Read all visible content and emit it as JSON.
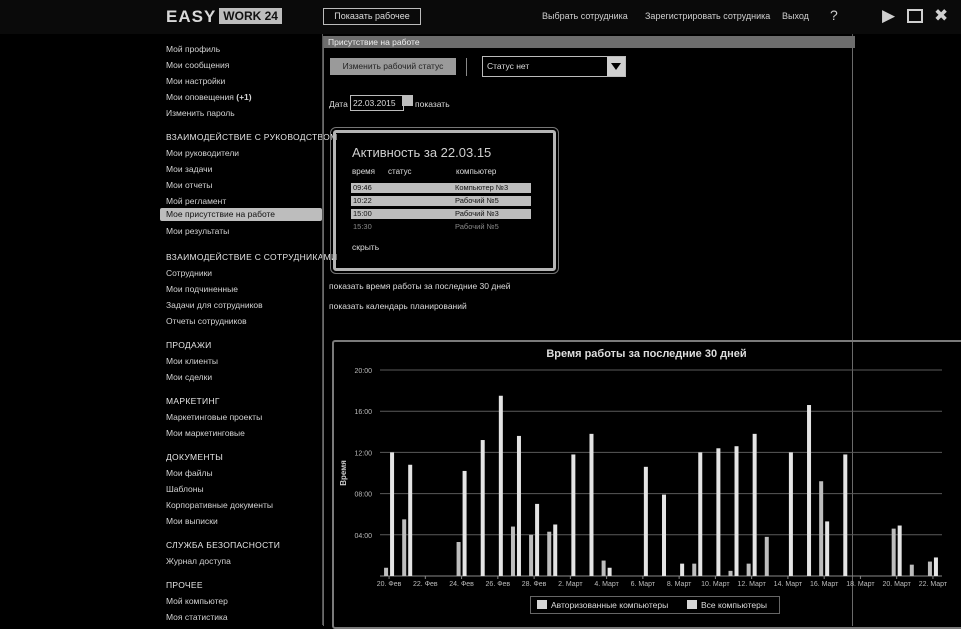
{
  "topbar": {
    "logo_main": "EASY",
    "logo_box": "WORK 24",
    "button": "Показать рабочее",
    "links": [
      "Выбрать сотрудника",
      "Зарегистрировать сотрудника",
      "Выход"
    ],
    "help_icon": "question-icon",
    "window_controls": [
      "play-icon",
      "maximize-icon",
      "close-icon"
    ]
  },
  "sidebar": {
    "top_items": [
      "Мой профиль",
      "Мои сообщения",
      "Мои настройки",
      "Мои оповещения",
      "Изменить пароль"
    ],
    "top_badge": "(+1)",
    "groups": [
      {
        "title": "Взаимодействие с руководством",
        "items": [
          "Мои руководители",
          "Мои задачи",
          "Мои отчеты",
          "Мой регламент",
          "Мое присутствие на работе",
          "Мои результаты"
        ],
        "active_index": 4
      },
      {
        "title": "Взаимодействие с сотрудниками",
        "items": [
          "Сотрудники",
          "Мои подчиненные",
          "Задачи для сотрудников",
          "Отчеты сотрудников"
        ]
      },
      {
        "title": "Продажи",
        "items": [
          "Мои клиенты",
          "Мои сделки"
        ]
      },
      {
        "title": "Маркетинг",
        "items": [
          "Маркетинговые проекты",
          "Мои маркетинговые"
        ]
      },
      {
        "title": "Документы",
        "items": [
          "Мои файлы",
          "Шаблоны",
          "Корпоративные документы",
          "Мои выписки"
        ]
      },
      {
        "title": "Служба безопасности",
        "items": [
          "Журнал доступа"
        ]
      },
      {
        "title": "Прочее",
        "items": [
          "Мой компьютер",
          "Моя статистика"
        ]
      }
    ]
  },
  "main": {
    "panel_title": "Присутствие на работе",
    "add_status_button": "Изменить рабочий статус",
    "status_select_value": "Статус нет",
    "date_label": "Дата",
    "date_value": "22.03.2015",
    "show_label": "показать",
    "activity": {
      "title": "Активность за 22.03.15",
      "headers": [
        "время",
        "статус",
        "компьютер"
      ],
      "rows": [
        {
          "time": "09:46",
          "status": "",
          "computer": "Компьютер №3"
        },
        {
          "time": "10:22",
          "status": "",
          "computer": "Рабочий №5"
        },
        {
          "time": "15:00",
          "status": "",
          "computer": "Рабочий №3"
        },
        {
          "time": "15:30",
          "status": "",
          "computer": "Рабочий №5"
        }
      ],
      "hide_label": "скрыть"
    },
    "link_30_days": "показать время работы за последние 30 дней",
    "link_calendar": "показать календарь планирований"
  },
  "chart_data": {
    "type": "bar",
    "title": "Время работы за последние 30 дней",
    "ylabel": "Время",
    "ylim": [
      0,
      20
    ],
    "y_ticks": [
      "20:00",
      "16:00",
      "12:00",
      "08:00",
      "04:00"
    ],
    "x_tick_labels": [
      "20. Фев",
      "22. Фев",
      "24. Фев",
      "26. Фев",
      "28. Фев",
      "2. Март",
      "4. Март",
      "6. Март",
      "8. Март",
      "10. Март",
      "12. Март",
      "14. Март",
      "16. Март",
      "18. Март",
      "20. Март",
      "22. Март"
    ],
    "categories": [
      "20 Фев",
      "21 Фев",
      "22 Фев",
      "23 Фев",
      "24 Фев",
      "25 Фев",
      "26 Фев",
      "27 Фев",
      "28 Фев",
      "1 Март",
      "2 Март",
      "3 Март",
      "4 Март",
      "5 Март",
      "6 Март",
      "7 Март",
      "8 Март",
      "9 Март",
      "10 Март",
      "11 Март",
      "12 Март",
      "13 Март",
      "14 Март",
      "15 Март",
      "16 Март",
      "17 Март",
      "18 Март",
      "19 Март",
      "20 Март",
      "21 Март",
      "22 Март"
    ],
    "series": [
      {
        "name": "Авторизованные компьютеры",
        "values": [
          0.8,
          5.5,
          0,
          0,
          3.3,
          0,
          0,
          4.8,
          4.0,
          4.3,
          0,
          0,
          1.5,
          0,
          0,
          0,
          0,
          1.2,
          0,
          0.5,
          1.2,
          3.8,
          0,
          0,
          9.2,
          0,
          0,
          0,
          4.6,
          1.1,
          1.4
        ],
        "color": "#bdbdbd"
      },
      {
        "name": "Все компьютеры",
        "values": [
          12.0,
          10.8,
          0,
          0,
          10.2,
          13.2,
          17.5,
          13.6,
          7.0,
          5.0,
          11.8,
          13.8,
          0.8,
          0,
          10.6,
          7.9,
          1.2,
          12.0,
          12.4,
          12.6,
          13.8,
          0,
          12.0,
          16.6,
          5.3,
          11.8,
          0,
          0,
          4.9,
          0,
          1.8
        ],
        "color": "#e4e4e4"
      }
    ],
    "legend_placement": "bottom",
    "grid": true
  }
}
